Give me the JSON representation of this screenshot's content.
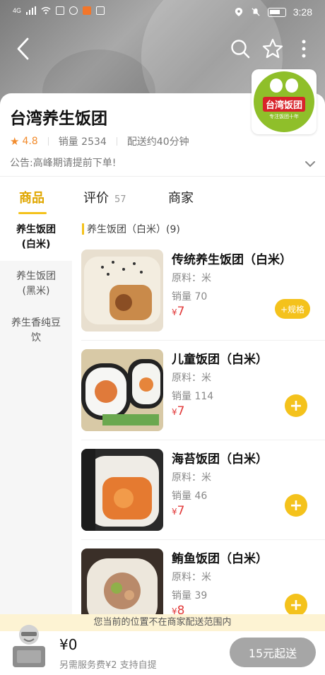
{
  "status_bar": {
    "signal": "4G",
    "time": "3:28"
  },
  "shop": {
    "name": "台湾养生饭团",
    "rating": "4.8",
    "sales": "销量 2534",
    "delivery": "配送约40分钟",
    "notice": "公告:高峰期请提前下单!",
    "logo_text": "台湾饭团",
    "logo_sub": "专注饭团十年"
  },
  "tabs": [
    {
      "label": "商品"
    },
    {
      "label": "评价",
      "count": "57"
    },
    {
      "label": "商家"
    }
  ],
  "sidebar": [
    {
      "label": "养生饭团(白米)"
    },
    {
      "label": "养生饭团(黑米)"
    },
    {
      "label": "养生香纯豆饮"
    }
  ],
  "category_header": "养生饭团（白米）(9)",
  "products": [
    {
      "name": "传统养生饭团（白米）",
      "desc": "原料：米",
      "sales": "销量 70",
      "currency": "¥",
      "price": "7",
      "action": "+规格"
    },
    {
      "name": "儿童饭团（白米）",
      "desc": "原料：米",
      "sales": "销量 114",
      "currency": "¥",
      "price": "7",
      "action": "+"
    },
    {
      "name": "海苔饭团（白米）",
      "desc": "原料：米",
      "sales": "销量 46",
      "currency": "¥",
      "price": "7",
      "action": "+"
    },
    {
      "name": "鲔鱼饭团（白米）",
      "desc": "原料：米",
      "sales": "销量 39",
      "currency": "¥",
      "price": "8",
      "action": "+"
    }
  ],
  "range_notice": "您当前的位置不在商家配送范围内",
  "cart": {
    "total": "¥0",
    "fee": "另需服务费¥2 支持自提",
    "checkout": "15元起送"
  },
  "colors": {
    "accent": "#f4c21c",
    "price": "#e23b3b",
    "rating": "#f28c2e"
  }
}
